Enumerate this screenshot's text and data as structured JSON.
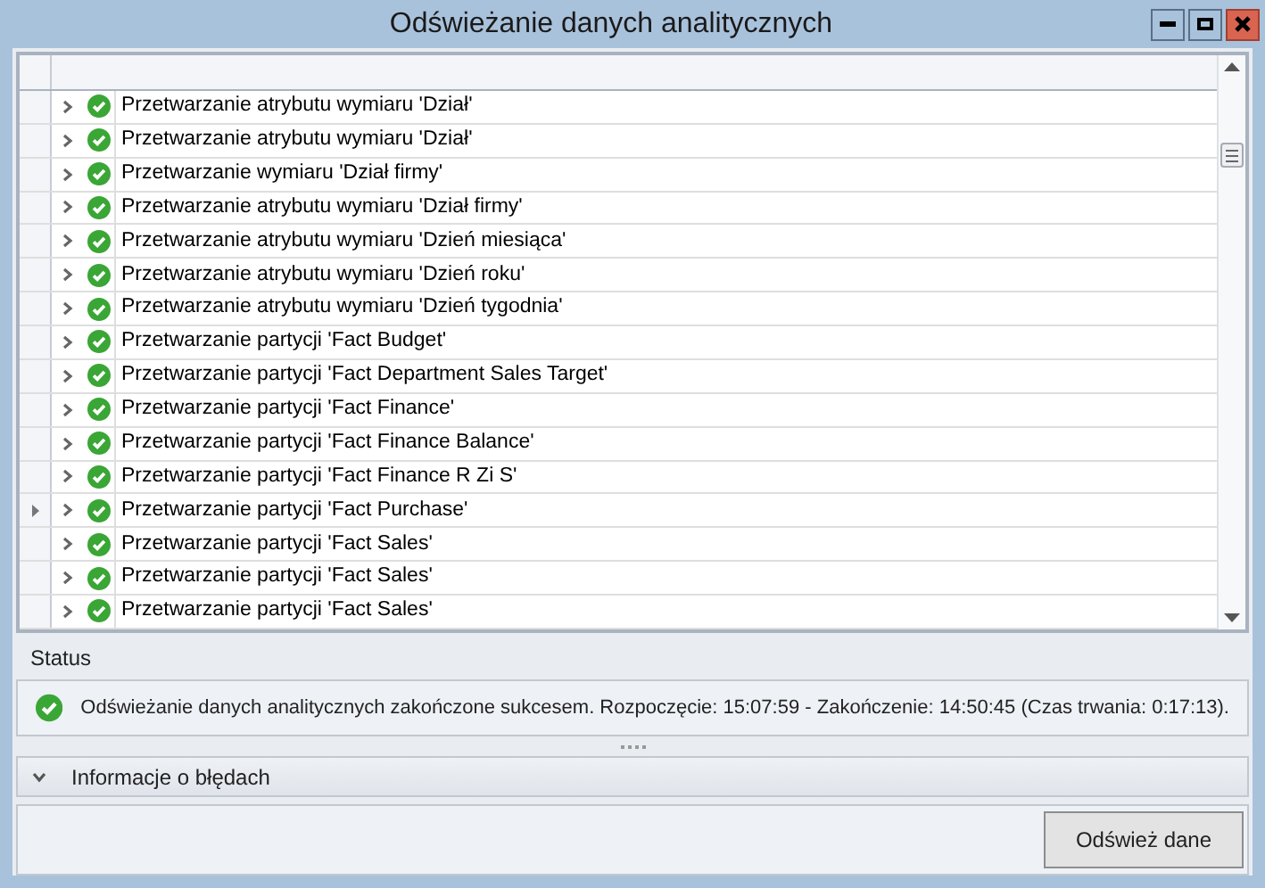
{
  "window": {
    "title": "Odświeżanie danych analitycznych"
  },
  "rows": [
    {
      "text": "Przetwarzanie atrybutu wymiaru 'Dział'",
      "selected": false
    },
    {
      "text": "Przetwarzanie atrybutu wymiaru 'Dział'",
      "selected": false
    },
    {
      "text": "Przetwarzanie wymiaru 'Dział firmy'",
      "selected": false
    },
    {
      "text": "Przetwarzanie atrybutu wymiaru 'Dział firmy'",
      "selected": false
    },
    {
      "text": "Przetwarzanie atrybutu wymiaru 'Dzień miesiąca'",
      "selected": false
    },
    {
      "text": "Przetwarzanie atrybutu wymiaru 'Dzień roku'",
      "selected": false
    },
    {
      "text": "Przetwarzanie atrybutu wymiaru 'Dzień tygodnia'",
      "selected": false
    },
    {
      "text": "Przetwarzanie partycji 'Fact Budget'",
      "selected": false
    },
    {
      "text": "Przetwarzanie partycji 'Fact Department Sales Target'",
      "selected": false
    },
    {
      "text": "Przetwarzanie partycji 'Fact Finance'",
      "selected": false
    },
    {
      "text": "Przetwarzanie partycji 'Fact Finance Balance'",
      "selected": false
    },
    {
      "text": "Przetwarzanie partycji 'Fact Finance R Zi S'",
      "selected": false
    },
    {
      "text": "Przetwarzanie partycji 'Fact Purchase'",
      "selected": true
    },
    {
      "text": "Przetwarzanie partycji 'Fact Sales'",
      "selected": false
    },
    {
      "text": "Przetwarzanie partycji 'Fact Sales'",
      "selected": false
    },
    {
      "text": "Przetwarzanie partycji 'Fact Sales'",
      "selected": false
    }
  ],
  "status": {
    "label": "Status",
    "message": "Odświeżanie danych analitycznych zakończone sukcesem. Rozpoczęcie: 15:07:59 - Zakończenie: 14:50:45 (Czas trwania: 0:17:13)."
  },
  "errors": {
    "label": "Informacje o błędach",
    "expanded": false
  },
  "buttons": [
    "Odśwież dane"
  ]
}
